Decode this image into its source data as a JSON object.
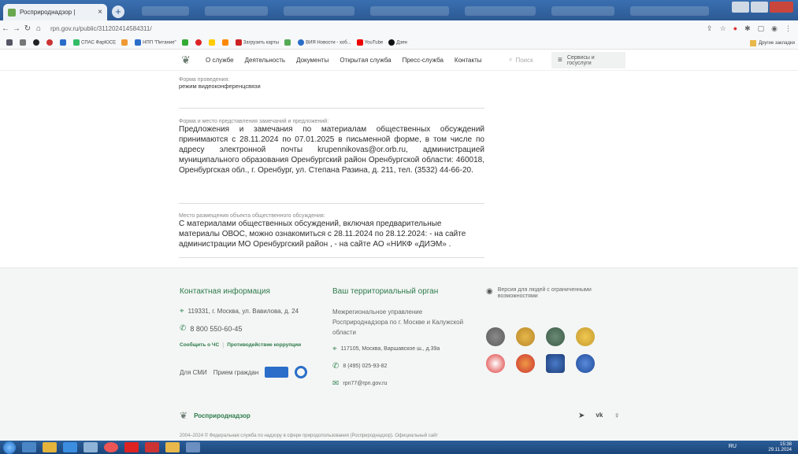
{
  "browser": {
    "tab_title": "Росприроднадзор |",
    "tab_close": "×",
    "new_tab": "+",
    "url": "rpn.gov.ru/public/311202414584311/",
    "bookmarks": [
      "СПАС ФарЮСЕ",
      "НПП \"Питание\"",
      "Загрузить карты",
      "ВИЯ Новости - хоб...",
      "YouTube",
      "Дзен"
    ],
    "other_bookmarks": "Другие закладки"
  },
  "header": {
    "nav": [
      "О службе",
      "Деятельность",
      "Документы",
      "Открытая служба",
      "Пресс-служба",
      "Контакты"
    ],
    "search": "Поиск",
    "services_label": "Сервисы и госуслуги"
  },
  "content": {
    "format": {
      "label": "Форма проведения:",
      "value": "режим видеоконференцсвязи"
    },
    "proposals": {
      "label": "Форма и место представления замечаний и предложений:",
      "value": "Предложения и замечания по материалам общественных обсуждений принимаются с 28.11.2024 по 07.01.2025 в письменной форме, в том числе по адресу электронной почты krupennikovas@or.orb.ru, администрацией муниципального образования Оренбургский район Оренбургской области: 460018, Оренбургская обл., г. Оренбург, ул. Степана Разина, д. 211, тел. (3532) 44-66-20."
    },
    "placement": {
      "label": "Место размещения объекта общественного обсуждения:",
      "value": "С материалами общественных обсуждений, включая предварительные материалы ОВОС, можно ознакомиться с 28.11.2024 по 28.12.2024: - на сайте администрации МО Оренбургский район , - на сайте АО «НИКФ «ДИЭМ» ."
    }
  },
  "footer": {
    "contacts": {
      "heading": "Контактная информация",
      "address": "119331, г. Москва, ул. Вавилова, д. 24",
      "phone": "8 800 550-60-45",
      "link_emergency": "Сообщить о ЧС",
      "link_corruption": "Противодействие коррупции",
      "media": "Для СМИ",
      "citizens": "Прием граждан"
    },
    "territorial": {
      "heading": "Ваш территориальный орган",
      "name": "Межрегиональное управление Росприроднадзора по г. Москве и Калужской области",
      "address": "117105, Москва, Варшавское ш., д.39а",
      "phone": "8 (495) 025-93-82",
      "email": "rpn77@rpn.gov.ru"
    },
    "accessibility": "Версия для людей с ограниченными возможностями",
    "brand": "Росприроднадзор",
    "copyright": "2004–2024 © Федеральная служба по надзору в сфере природопользования (Росприроднадзор). Официальный сайт"
  },
  "taskbar": {
    "lang": "RU",
    "time": "15:38",
    "date": "29.11.2024"
  },
  "colors": {
    "accent_green": "#2d7a4a",
    "browser_blue": "#2c5a94",
    "taskbar_blue": "#1b467a"
  }
}
